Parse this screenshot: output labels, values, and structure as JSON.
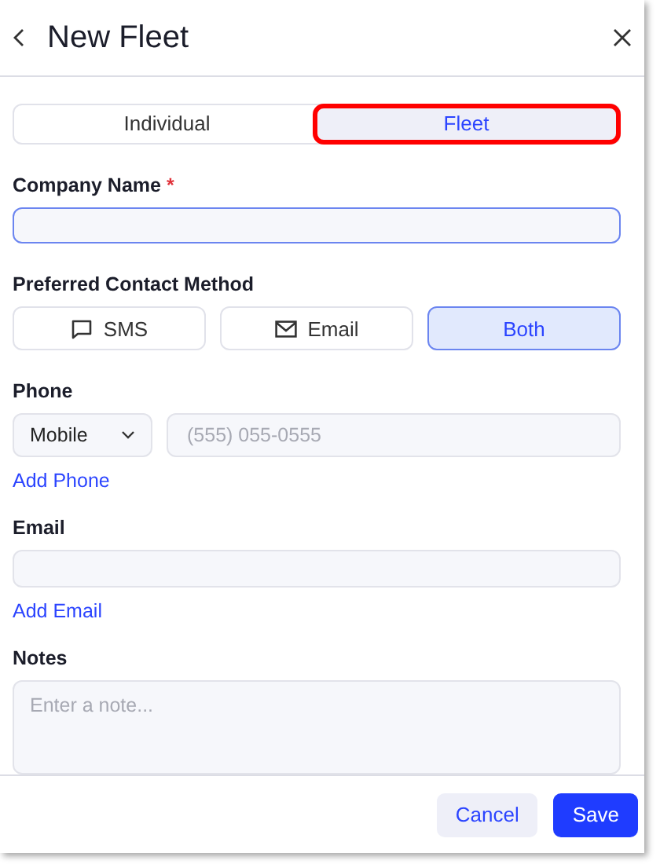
{
  "header": {
    "title": "New Fleet"
  },
  "tabs": [
    {
      "label": "Individual",
      "selected": false,
      "highlighted": false
    },
    {
      "label": "Fleet",
      "selected": true,
      "highlighted": true
    }
  ],
  "company_name": {
    "label": "Company Name",
    "required_mark": "*",
    "focused": true
  },
  "contact_method": {
    "label": "Preferred Contact Method",
    "options": [
      {
        "label": "SMS",
        "kind": "sms",
        "selected": false
      },
      {
        "label": "Email",
        "kind": "email",
        "selected": false
      },
      {
        "label": "Both",
        "kind": "none",
        "selected": true
      }
    ]
  },
  "phone": {
    "label": "Phone",
    "type": "Mobile",
    "placeholder": "(555) 055-0555",
    "add_link": "Add Phone"
  },
  "email": {
    "label": "Email",
    "add_link": "Add Email"
  },
  "notes": {
    "label": "Notes",
    "placeholder": "Enter a note..."
  },
  "footer": {
    "buttons": [
      {
        "label": "Cancel",
        "kind": "secondary"
      },
      {
        "label": "Save",
        "kind": "primary"
      }
    ]
  }
}
